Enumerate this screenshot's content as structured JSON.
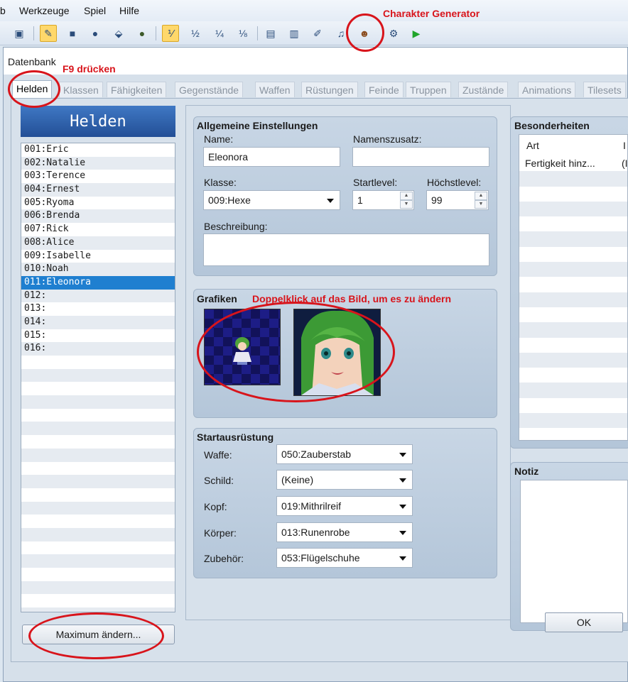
{
  "menu": [
    "b",
    "Werkzeuge",
    "Spiel",
    "Hilfe"
  ],
  "dialog": {
    "title": "Datenbank"
  },
  "tabs": [
    "Helden",
    "Klassen",
    "Fähigkeiten",
    "Gegenstände",
    "Waffen",
    "Rüstungen",
    "Feinde",
    "Truppen",
    "Zustände",
    "Animations",
    "Tilesets"
  ],
  "list": {
    "header": "Helden",
    "items": [
      "001:Eric",
      "002:Natalie",
      "003:Terence",
      "004:Ernest",
      "005:Ryoma",
      "006:Brenda",
      "007:Rick",
      "008:Alice",
      "009:Isabelle",
      "010:Noah",
      "011:Eleonora",
      "012:",
      "013:",
      "014:",
      "015:",
      "016:"
    ],
    "selected_index": 10,
    "max_button": "Maximum ändern..."
  },
  "general": {
    "title": "Allgemeine Einstellungen",
    "name_label": "Name:",
    "name_value": "Eleonora",
    "nickname_label": "Namenszusatz:",
    "nickname_value": "",
    "class_label": "Klasse:",
    "class_value": "009:Hexe",
    "start_level_label": "Startlevel:",
    "start_level_value": "1",
    "max_level_label": "Höchstlevel:",
    "max_level_value": "99",
    "description_label": "Beschreibung:",
    "description_value": ""
  },
  "graphics": {
    "title": "Grafiken"
  },
  "equipment": {
    "title": "Startausrüstung",
    "rows": [
      {
        "label": "Waffe:",
        "value": "050:Zauberstab"
      },
      {
        "label": "Schild:",
        "value": "(Keine)"
      },
      {
        "label": "Kopf:",
        "value": "019:Mithrilreif"
      },
      {
        "label": "Körper:",
        "value": "013:Runenrobe"
      },
      {
        "label": "Zubehör:",
        "value": "053:Flügelschuhe"
      }
    ]
  },
  "traits": {
    "title": "Besonderheiten",
    "col_type": "Art",
    "col_content": "I",
    "rows": [
      {
        "type": "Fertigkeit hinz...",
        "content": "(I"
      }
    ]
  },
  "notes": {
    "title": "Notiz",
    "value": ""
  },
  "ok_button": "OK",
  "annotations": {
    "generator": "Charakter Generator",
    "f9": "F9 drücken",
    "doubleclick": "Doppelklick auf das Bild, um es zu ändern"
  },
  "colors": {
    "accent": "#d8141b",
    "selection": "#1f7fd0",
    "header": "#234f96"
  }
}
